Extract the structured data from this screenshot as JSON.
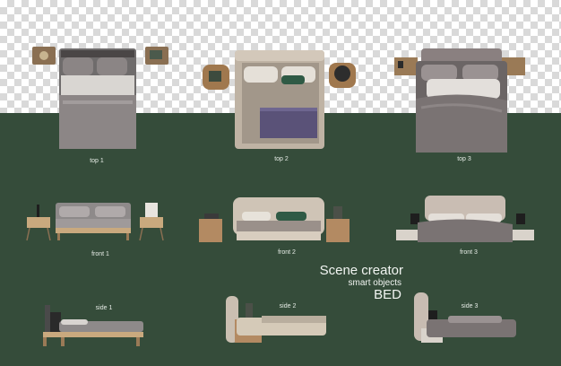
{
  "labels": {
    "top1": "top 1",
    "top2": "top 2",
    "top3": "top 3",
    "front1": "front 1",
    "front2": "front 2",
    "front3": "front 3",
    "side1": "side 1",
    "side2": "side 2",
    "side3": "side 3"
  },
  "title": {
    "line1": "Scene creator",
    "line2": "smart objects",
    "line3": "BED"
  },
  "colors": {
    "floor": "#354c3a",
    "checker_light": "#ffffff",
    "checker_dark": "#d9d9d9",
    "label_text": "#e6ece6"
  }
}
